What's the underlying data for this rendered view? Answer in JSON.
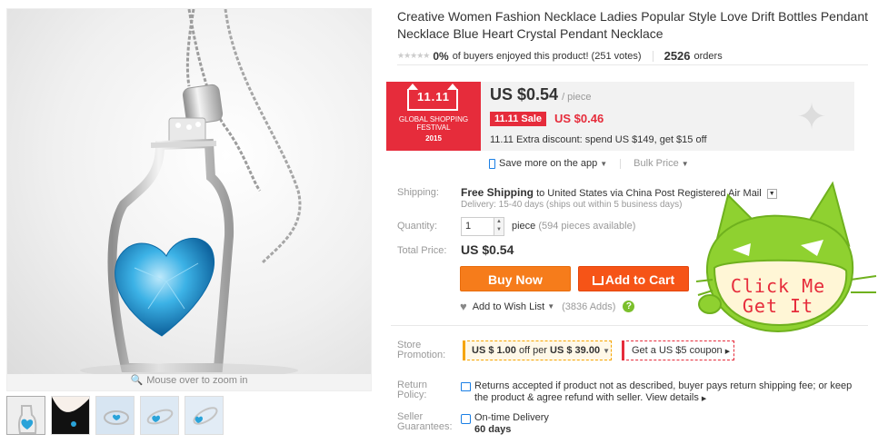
{
  "product": {
    "title": "Creative Women Fashion Necklace Ladies Popular Style Love Drift Bottles Pendant Necklace Blue Heart Crystal Pendant Necklace"
  },
  "gallery": {
    "zoom_hint": "Mouse over to zoom in",
    "thumbnail_count": 5
  },
  "rating": {
    "percent": "0%",
    "text": "of buyers enjoyed this product! (251 votes)",
    "orders_count": "2526",
    "orders_label": "orders"
  },
  "festival_badge": {
    "date": "11.11",
    "line1": "GLOBAL SHOPPING",
    "line2": "FESTIVAL",
    "year": "2015"
  },
  "price": {
    "main": "US $0.54",
    "unit": "/ piece",
    "sale_tag": "11.11 Sale",
    "sale_price": "US $0.46",
    "extra_discount": "11.11 Extra discount: spend US $149, get $15 off"
  },
  "app_row": {
    "save_more": "Save more on the app",
    "bulk_price": "Bulk Price"
  },
  "shipping": {
    "label": "Shipping:",
    "free": "Free Shipping",
    "detail": "to United States via China Post Registered Air Mail",
    "delivery": "Delivery: 15-40 days (ships out within 5 business days)"
  },
  "quantity": {
    "label": "Quantity:",
    "value": "1",
    "unit": "piece",
    "available": "(594 pieces available)"
  },
  "total": {
    "label": "Total Price:",
    "value": "US $0.54"
  },
  "buttons": {
    "buy_now": "Buy Now",
    "add_to_cart": "Add to Cart"
  },
  "wishlist": {
    "label": "Add to Wish List",
    "count": "(3836 Adds)",
    "help": "?"
  },
  "promotion": {
    "label_line1": "Store",
    "label_line2": "Promotion:",
    "coupon_a": "US $ 1.00",
    "coupon_b": "off per",
    "coupon_c": "US $ 39.00",
    "get_coupon": "Get a US $5 coupon"
  },
  "return_policy": {
    "label_line1": "Return",
    "label_line2": "Policy:",
    "text": "Returns accepted if product not as described, buyer pays return shipping fee; or keep the product & agree refund with seller.",
    "link": "View details"
  },
  "guarantees": {
    "label_line1": "Seller",
    "label_line2": "Guarantees:",
    "ontime": "On-time Delivery",
    "days": "60 days"
  },
  "click_me": {
    "line1": "Click Me",
    "line2": "Get It"
  },
  "colors": {
    "accent_red": "#e62c3b",
    "buy_orange": "#f67c1b",
    "cart_orange": "#f65417",
    "cat_green": "#8fd130",
    "crystal_blue": "#2aa3d9"
  }
}
